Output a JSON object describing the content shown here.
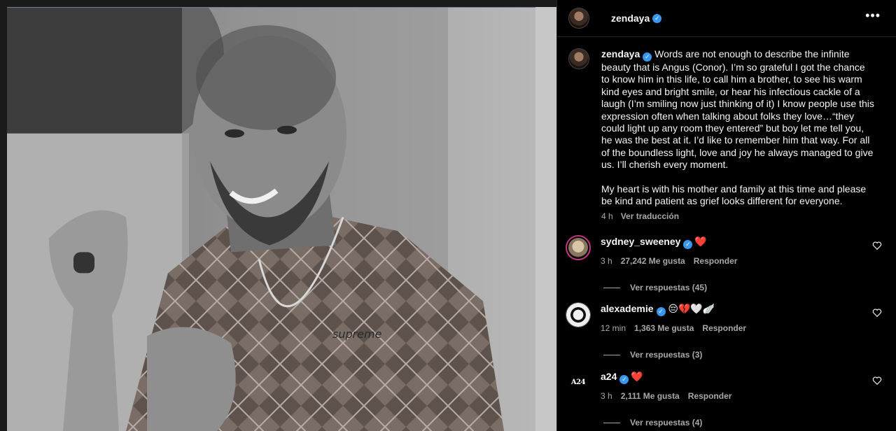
{
  "post": {
    "username": "zendaya",
    "caption_p1": "Words are not enough to describe the infinite beauty that is Angus (Conor). I’m so grateful I got the chance to know him in this life, to call him a brother, to see his warm kind eyes and bright smile, or hear his infectious cackle of a laugh (I’m smiling now just thinking of it) I know people use this expression often when talking about folks they love…“they could light up any room they entered” but boy let me tell you, he was the best at it. I’d like to remember him that way. For all of the boundless light, love and joy he always managed to give us. I’ll cherish every moment.",
    "caption_p2": "My heart is with his mother and family at this time and please be kind and patient as grief looks different for everyone.",
    "time": "4 h",
    "translate": "Ver traducción",
    "more_icon": "more-options-icon",
    "photo_print": "supreme"
  },
  "comments": [
    {
      "username": "sydney_sweeney",
      "text": "❤️",
      "time": "3 h",
      "likes": "27,242 Me gusta",
      "reply": "Responder",
      "replies": "Ver respuestas (45)"
    },
    {
      "username": "alexademie",
      "text": "😔💔🤍🪽",
      "time": "12 min",
      "likes": "1,363 Me gusta",
      "reply": "Responder",
      "replies": "Ver respuestas (3)"
    },
    {
      "username": "a24",
      "avatar_text": "A24",
      "text": "❤️",
      "time": "3 h",
      "likes": "2,111 Me gusta",
      "reply": "Responder",
      "replies": "Ver respuestas (4)"
    }
  ],
  "colors": {
    "verified": "#3897f0",
    "muted": "#a8a8a8",
    "accent": "#ed4956"
  }
}
